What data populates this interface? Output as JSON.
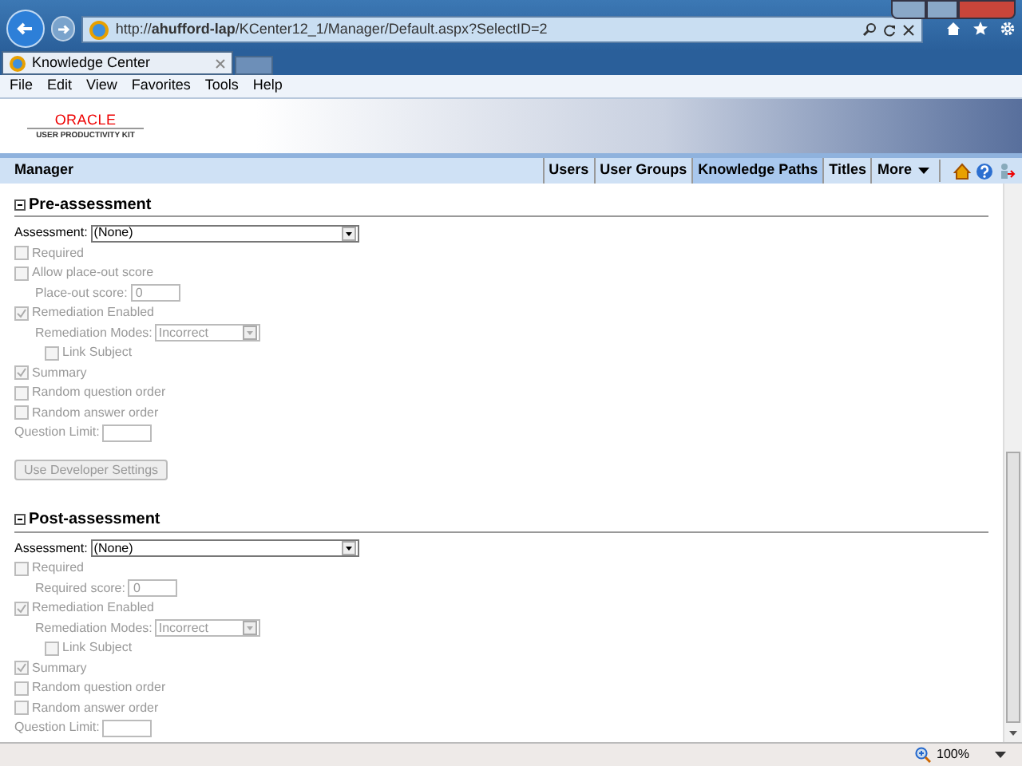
{
  "browser": {
    "address": "http://**ahufford-lap**/KCenter12_1/Manager/Default.aspx?SelectID=2",
    "tabs": [
      {
        "label": "Knowledge Center",
        "selected": true
      }
    ],
    "menu": [
      "File",
      "Edit",
      "View",
      "Favorites",
      "Tools",
      "Help"
    ]
  },
  "header": {
    "logo": "ORACLE",
    "logo_sub": "USER PRODUCTIVITY KIT"
  },
  "nav": {
    "title": "Manager",
    "tabs": [
      {
        "label": "Users",
        "selected": false
      },
      {
        "label": "User Groups",
        "selected": false
      },
      {
        "label": "Knowledge Paths",
        "selected": true
      },
      {
        "label": "Titles",
        "selected": false
      },
      {
        "label": "More",
        "selected": false
      }
    ]
  },
  "sections": [
    {
      "title": "Pre-assessment",
      "expanded": true,
      "items": [
        {
          "kind": "select",
          "label": "Assessment:",
          "value": "(None)",
          "disabled": false
        },
        {
          "kind": "checkbox",
          "label": "Required",
          "checked": false,
          "disabled": true
        },
        {
          "kind": "checkbox",
          "label": "Allow place-out score",
          "checked": false,
          "disabled": true,
          "children": [
            {
              "kind": "field",
              "label": "Place-out score:",
              "value": "0",
              "disabled": true
            }
          ]
        },
        {
          "kind": "checkbox",
          "label": "Remediation Enabled",
          "checked": true,
          "disabled": true,
          "children": [
            {
              "kind": "select",
              "label": "Remediation Modes:",
              "value": "Incorrect",
              "disabled": true,
              "children": [
                {
                  "kind": "checkbox",
                  "label": "Link Subject",
                  "checked": false,
                  "disabled": true
                }
              ]
            }
          ]
        },
        {
          "kind": "checkbox",
          "label": "Summary",
          "checked": true,
          "disabled": true
        },
        {
          "kind": "checkbox",
          "label": "Random question order",
          "checked": false,
          "disabled": true
        },
        {
          "kind": "checkbox",
          "label": "Random answer order",
          "checked": false,
          "disabled": true
        },
        {
          "kind": "field",
          "label": "Question Limit:",
          "disabled": true
        },
        {
          "kind": "button",
          "label": "Use Developer Settings",
          "disabled": true
        }
      ]
    },
    {
      "title": "Post-assessment",
      "expanded": true,
      "items": [
        {
          "kind": "select",
          "label": "Assessment:",
          "value": "(None)",
          "disabled": false
        },
        {
          "kind": "checkbox",
          "label": "Required",
          "checked": false,
          "disabled": true,
          "children": [
            {
              "kind": "field",
              "label": "Required score:",
              "value": "0",
              "disabled": true
            }
          ]
        },
        {
          "kind": "checkbox",
          "label": "Remediation Enabled",
          "checked": true,
          "disabled": true,
          "children": [
            {
              "kind": "select",
              "label": "Remediation Modes:",
              "value": "Incorrect",
              "disabled": true,
              "children": [
                {
                  "kind": "checkbox",
                  "label": "Link Subject",
                  "checked": false,
                  "disabled": true
                }
              ]
            }
          ]
        },
        {
          "kind": "checkbox",
          "label": "Summary",
          "checked": true,
          "disabled": true
        },
        {
          "kind": "checkbox",
          "label": "Random question order",
          "checked": false,
          "disabled": true
        },
        {
          "kind": "checkbox",
          "label": "Random answer order",
          "checked": false,
          "disabled": true
        },
        {
          "kind": "field",
          "label": "Question Limit:",
          "disabled": true
        }
      ]
    }
  ],
  "status_bar": {
    "zoom": "100%"
  }
}
